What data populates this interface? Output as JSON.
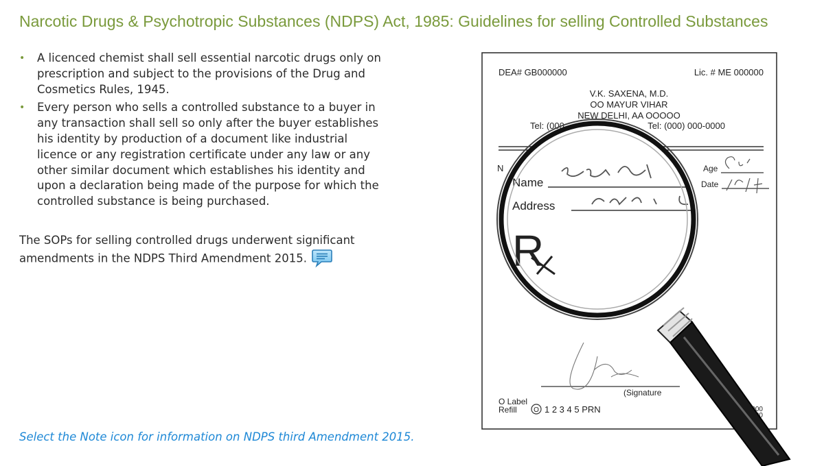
{
  "title": "Narcotic Drugs & Psychotropic Substances (NDPS) Act, 1985: Guidelines for selling Controlled Substances",
  "bullets": [
    "A licenced chemist shall sell essential narcotic drugs only on prescription and subject to the provisions of the Drug and Cosmetics Rules, 1945.",
    "Every person who sells a controlled substance to a buyer in any transaction shall sell so only after the buyer establishes his identity by production of a document like industrial licence or any registration certificate under any law or any other similar document which establishes his identity and upon a declaration being made of the purpose for which the controlled substance is being purchased."
  ],
  "paragraph": "The SOPs for selling controlled drugs underwent significant amendments in the NDPS Third Amendment 2015.",
  "instruction": "Select the Note icon for information on NDPS third Amendment 2015.",
  "prescription": {
    "dea": "DEA# GB000000",
    "lic": "Lic. # ME 000000",
    "doctor": "V.K. SAXENA, M.D.",
    "address1": "OO MAYUR VIHAR",
    "address2": "NEW DELHI, AA OOOOO",
    "tel_left": "Tel: (000",
    "tel_right": "Tel: (000) 000-0000",
    "name_label": "Name",
    "address_label": "Address",
    "age_label": "Age",
    "date_label": "Date",
    "n_label": "N",
    "rx_symbol": "R",
    "signature_label": "(Signature",
    "label_line": "O Label",
    "refill_label": "Refill",
    "refill_zero": "O",
    "refill_options": "1 2 3 4 5 PRN",
    "bottom_right_1": "0-000",
    "bottom_right_2": "0000"
  },
  "icons": {
    "note": "note-icon",
    "magnifier": "magnifying-glass-icon"
  },
  "colors": {
    "title": "#7a9a3c",
    "instruction": "#1e88d6",
    "bullet": "#7a9a3c"
  }
}
